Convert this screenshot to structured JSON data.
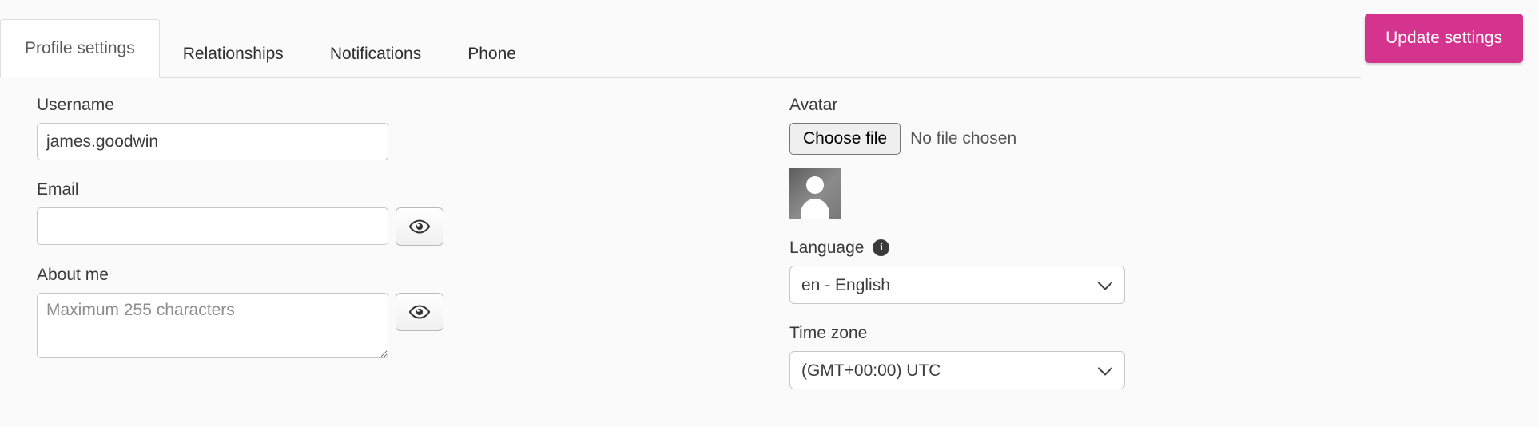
{
  "tabs": [
    {
      "label": "Profile settings",
      "active": true
    },
    {
      "label": "Relationships",
      "active": false
    },
    {
      "label": "Notifications",
      "active": false
    },
    {
      "label": "Phone",
      "active": false
    }
  ],
  "toolbar": {
    "update_label": "Update settings",
    "accent_color": "#d5348e"
  },
  "left_column": {
    "username": {
      "label": "Username",
      "value": "james.goodwin",
      "placeholder": ""
    },
    "email": {
      "label": "Email",
      "value": "",
      "placeholder": "",
      "toggle_icon": "eye-icon"
    },
    "about_me": {
      "label": "About me",
      "value": "",
      "placeholder": "Maximum 255 characters",
      "toggle_icon": "eye-icon"
    }
  },
  "right_column": {
    "avatar": {
      "label": "Avatar",
      "choose_file_label": "Choose file",
      "no_file_text": "No file chosen",
      "preview_icon": "user-silhouette-icon"
    },
    "language": {
      "label": "Language",
      "info_icon": "info-icon",
      "info_glyph": "i",
      "selected": "en - English",
      "options": [
        "en - English"
      ]
    },
    "time_zone": {
      "label": "Time zone",
      "selected": "(GMT+00:00) UTC",
      "options": [
        "(GMT+00:00) UTC"
      ]
    }
  }
}
